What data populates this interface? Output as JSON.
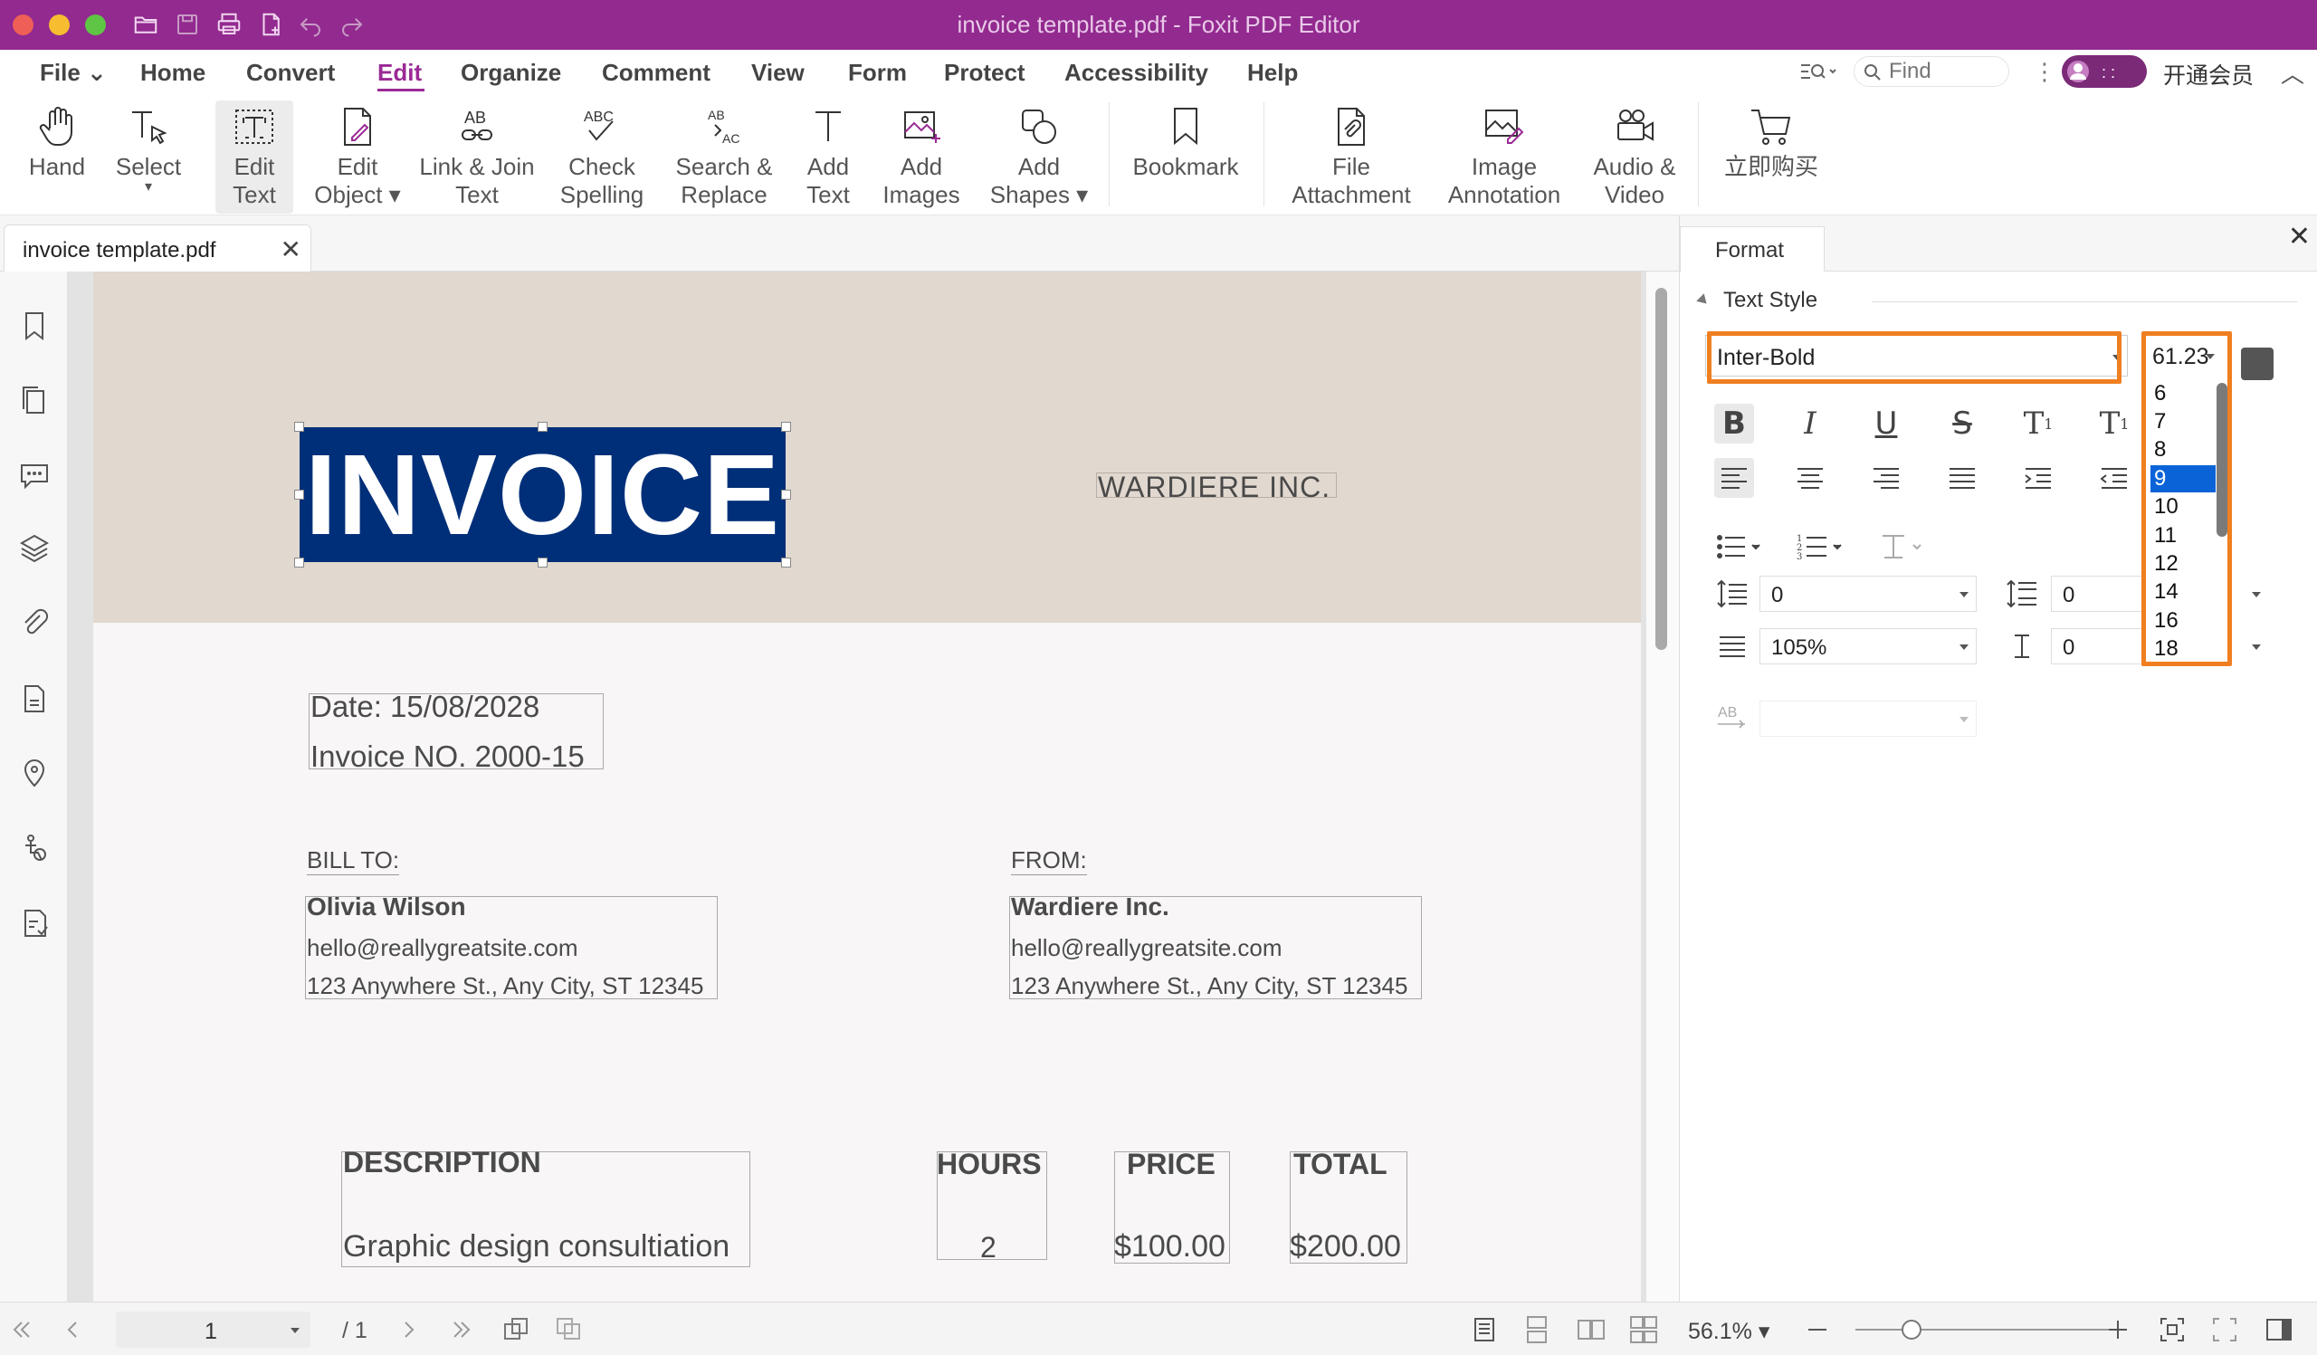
{
  "window": {
    "title": "invoice template.pdf - Foxit PDF Editor",
    "traffic_lights": [
      "#ed5f57",
      "#f5bd2f",
      "#5fc544"
    ],
    "accent": "#922a8f"
  },
  "quick_access": [
    "open-folder-icon",
    "save-icon",
    "print-icon",
    "new-doc-icon",
    "undo-icon",
    "redo-icon"
  ],
  "menu": {
    "items": [
      "File",
      "Home",
      "Convert",
      "Edit",
      "Organize",
      "Comment",
      "View",
      "Form",
      "Protect",
      "Accessibility",
      "Help"
    ],
    "active": "Edit",
    "find_placeholder": "Find",
    "vip_label": "开通会员"
  },
  "ribbon": {
    "buttons": [
      {
        "line1": "Hand",
        "line2": ""
      },
      {
        "line1": "Select",
        "line2": "▾"
      },
      {
        "line1": "Edit",
        "line2": "Text"
      },
      {
        "line1": "Edit",
        "line2": "Object ▾"
      },
      {
        "line1": "Link & Join",
        "line2": "Text"
      },
      {
        "line1": "Check",
        "line2": "Spelling"
      },
      {
        "line1": "Search &",
        "line2": "Replace"
      },
      {
        "line1": "Add",
        "line2": "Text"
      },
      {
        "line1": "Add",
        "line2": "Images"
      },
      {
        "line1": "Add",
        "line2": "Shapes ▾"
      },
      {
        "line1": "Bookmark",
        "line2": ""
      },
      {
        "line1": "File",
        "line2": "Attachment"
      },
      {
        "line1": "Image",
        "line2": "Annotation"
      },
      {
        "line1": "Audio &",
        "line2": "Video"
      },
      {
        "line1": "立即购买",
        "line2": ""
      }
    ]
  },
  "tab": {
    "label": "invoice template.pdf",
    "close": "✕"
  },
  "document": {
    "invoice_title": "INVOICE",
    "company": "WARDIERE INC.",
    "date": "Date: 15/08/2028",
    "invoice_no": "Invoice NO. 2000-15",
    "bill_to_label": "BILL TO:",
    "bill_to_name": "Olivia  Wilson",
    "bill_to_email": "hello@reallygreatsite.com",
    "bill_to_address": "123 Anywhere St., Any City, ST 12345",
    "from_label": "FROM:",
    "from_name": "Wardiere Inc.",
    "from_email": "hello@reallygreatsite.com",
    "from_address": "123 Anywhere St., Any City, ST 12345",
    "col_description": "DESCRIPTION",
    "col_hours": "HOURS",
    "col_price": "PRICE",
    "col_total": "TOTAL",
    "row_description": "Graphic design consultiation",
    "row_hours": "2",
    "row_price": "$100.00",
    "row_total": "$200.00",
    "header_color": "#e1d8cf",
    "title_bg": "#002f79"
  },
  "format_panel": {
    "tab_label": "Format",
    "close": "✕",
    "section": "Text Style",
    "font": "Inter-Bold",
    "size": "61.23",
    "size_options": [
      "6",
      "7",
      "8",
      "9",
      "10",
      "11",
      "12",
      "14",
      "16",
      "18"
    ],
    "selected_size": "9",
    "line_spacing": "0",
    "para_spacing": "0",
    "char_scale": "105%",
    "char_spacing": "0",
    "highlight_color": "#ef7f20"
  },
  "status": {
    "page": "1",
    "page_total": "/ 1",
    "zoom": "56.1%",
    "zoom_fraction": 0.17
  }
}
